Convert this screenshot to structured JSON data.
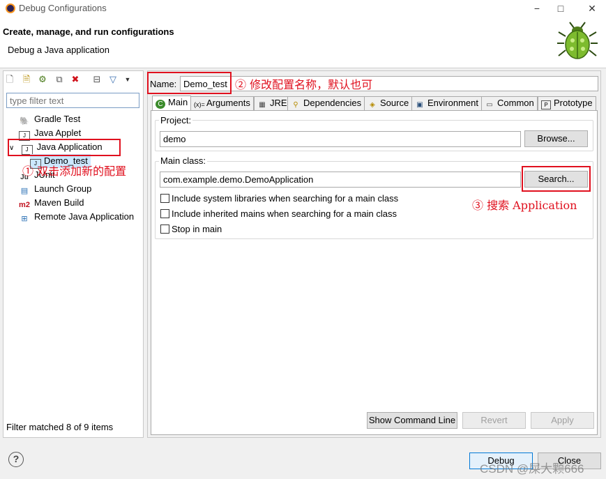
{
  "window": {
    "title": "Debug Configurations",
    "minimize": "−",
    "maximize": "□",
    "close": "✕"
  },
  "header": {
    "title": "Create, manage, and run configurations",
    "subtitle": "Debug a Java application"
  },
  "left": {
    "toolbar_icons": [
      "new-config-icon",
      "new-prototype-icon",
      "export-icon",
      "duplicate-icon",
      "delete-icon",
      "collapse-all-icon",
      "filter-icon",
      "dropdown-arrow-icon"
    ],
    "filter_placeholder": "type filter text",
    "tree": [
      {
        "label": "Gradle Test",
        "icon": "gradle-icon"
      },
      {
        "label": "Java Applet",
        "icon": "java-applet-icon"
      },
      {
        "label": "Java Application",
        "icon": "java-app-icon",
        "expanded": true
      },
      {
        "label": "Demo_test",
        "icon": "java-app-icon",
        "selected": true
      },
      {
        "label": "JUnit",
        "icon": "junit-icon"
      },
      {
        "label": "Launch Group",
        "icon": "launch-group-icon"
      },
      {
        "label": "Maven Build",
        "icon": "maven-icon"
      },
      {
        "label": "Remote Java Application",
        "icon": "remote-java-icon"
      }
    ],
    "status": "Filter matched 8 of 9 items"
  },
  "right": {
    "name_label": "Name:",
    "name_value": "Demo_test",
    "tabs": [
      {
        "label": "Main",
        "icon": "main-tab-icon",
        "active": true
      },
      {
        "label": "Arguments",
        "icon": "arguments-icon"
      },
      {
        "label": "JRE",
        "icon": "jre-icon"
      },
      {
        "label": "Dependencies",
        "icon": "dependencies-icon"
      },
      {
        "label": "Source",
        "icon": "source-icon"
      },
      {
        "label": "Environment",
        "icon": "environment-icon"
      },
      {
        "label": "Common",
        "icon": "common-icon"
      },
      {
        "label": "Prototype",
        "icon": "prototype-icon"
      }
    ],
    "project_label": "Project:",
    "project_value": "demo",
    "browse_label": "Browse...",
    "main_class_label": "Main class:",
    "main_class_value": "com.example.demo.DemoApplication",
    "search_label": "Search...",
    "checkboxes": [
      {
        "label": "Include system libraries when searching for a main class",
        "checked": false
      },
      {
        "label": "Include inherited mains when searching for a main class",
        "checked": false
      },
      {
        "label": "Stop in main",
        "checked": false
      }
    ],
    "show_command_line": "Show Command Line",
    "revert": "Revert",
    "apply": "Apply"
  },
  "bottom": {
    "help": "?",
    "debug": "Debug",
    "close": "Close"
  },
  "annotations": {
    "note1": "① 双击添加新的配置",
    "note2": "② 修改配置名称，默认也可",
    "note3": "③ 搜索 Application",
    "watermark": "CSDN @屎大颗666"
  },
  "colors": {
    "annotation_red": "#e0101e",
    "selection": "#cce8ff",
    "accent": "#0078d7"
  }
}
